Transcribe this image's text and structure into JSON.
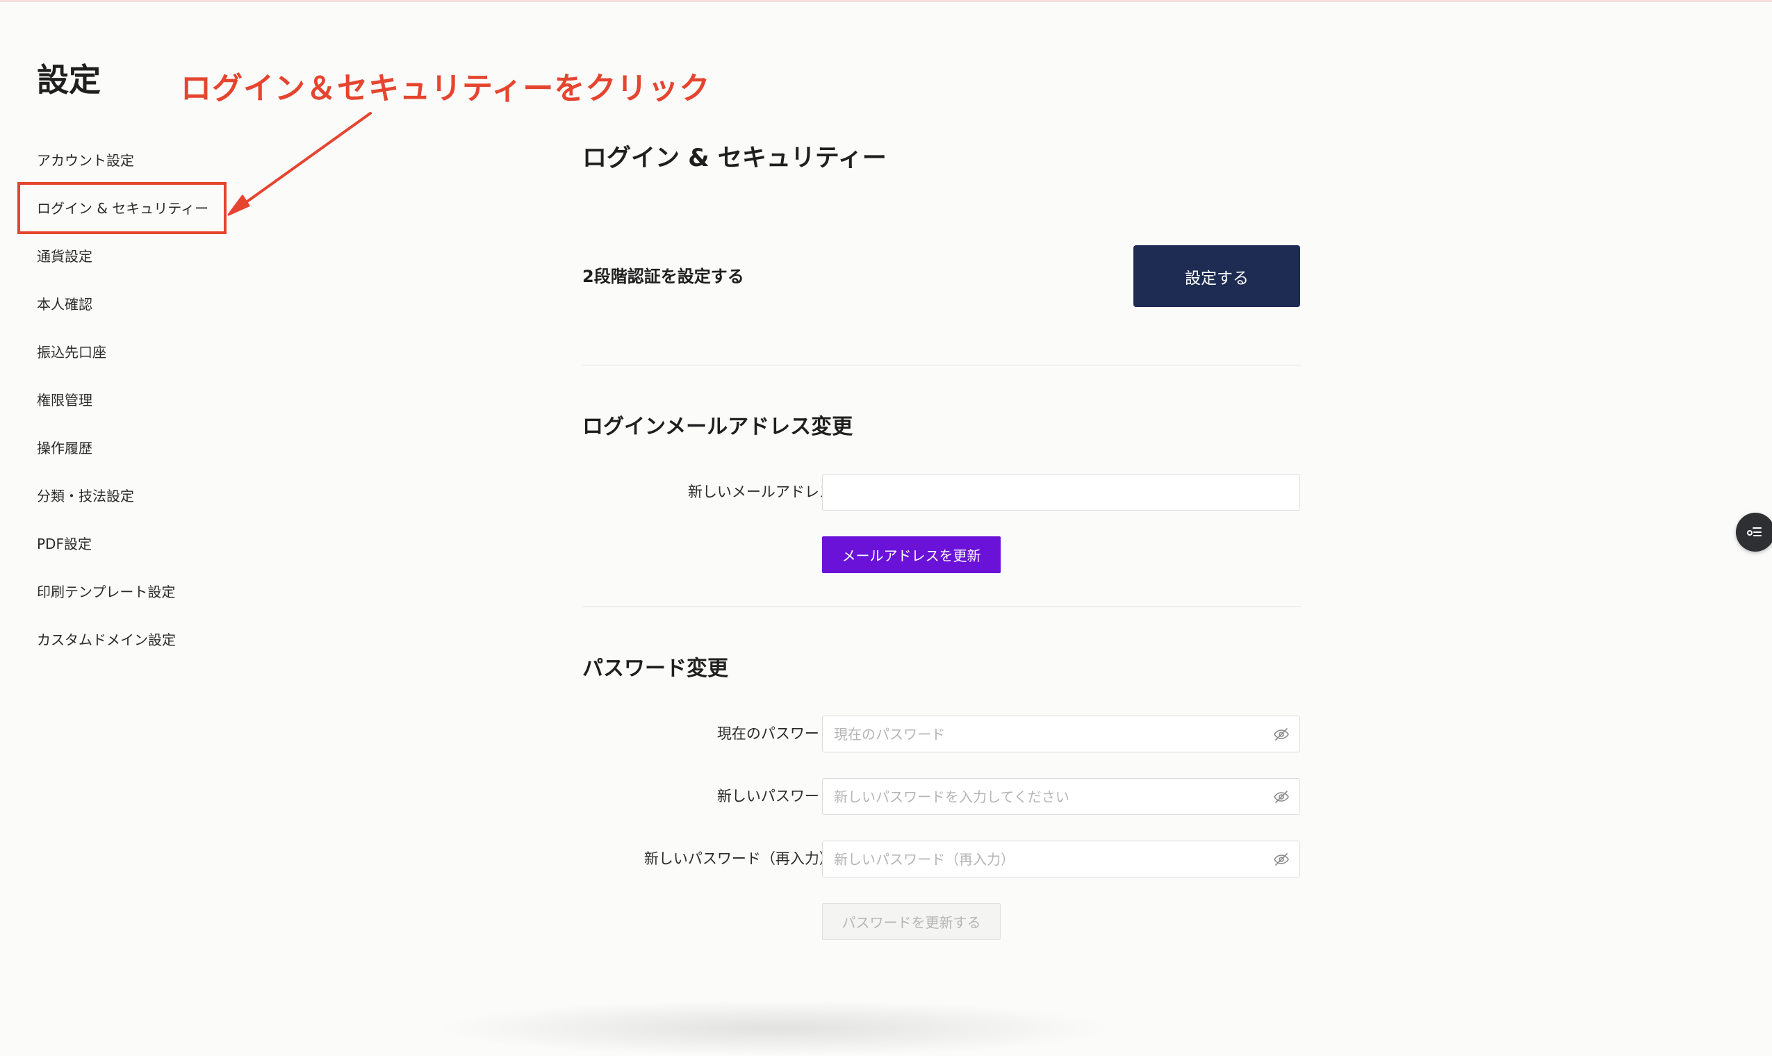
{
  "page_title": "設定",
  "sidebar": {
    "items": [
      {
        "label": "アカウント設定"
      },
      {
        "label": "ログイン & セキュリティー"
      },
      {
        "label": "通貨設定"
      },
      {
        "label": "本人確認"
      },
      {
        "label": "振込先口座"
      },
      {
        "label": "権限管理"
      },
      {
        "label": "操作履歴"
      },
      {
        "label": "分類・技法設定"
      },
      {
        "label": "PDF設定"
      },
      {
        "label": "印刷テンプレート設定"
      },
      {
        "label": "カスタムドメイン設定"
      }
    ]
  },
  "annotation": {
    "text": "ログイン＆セキュリティーをクリック",
    "color": "#e5452f"
  },
  "main": {
    "title": "ログイン & セキュリティー",
    "two_factor": {
      "label": "2段階認証を設定する",
      "button_label": "設定する"
    },
    "email_section": {
      "title": "ログインメールアドレス変更",
      "new_email_label": "新しいメールアドレス:",
      "new_email_value": "",
      "update_button_label": "メールアドレスを更新"
    },
    "password_section": {
      "title": "パスワード変更",
      "current_label": "現在のパスワード:",
      "current_placeholder": "現在のパスワード",
      "new_label": "新しいパスワード:",
      "new_placeholder": "新しいパスワードを入力してください",
      "confirm_label": "新しいパスワード（再入力）:",
      "confirm_placeholder": "新しいパスワード（再入力）",
      "update_button_label": "パスワードを更新する"
    }
  },
  "icons": {
    "password_toggle": "eye-off-icon",
    "floating_widget": "list-icon"
  },
  "colors": {
    "primary_dark": "#1e2b52",
    "accent_purple": "#6a12d8",
    "annotation_red": "#e5452f",
    "background": "#fbfbfa"
  }
}
